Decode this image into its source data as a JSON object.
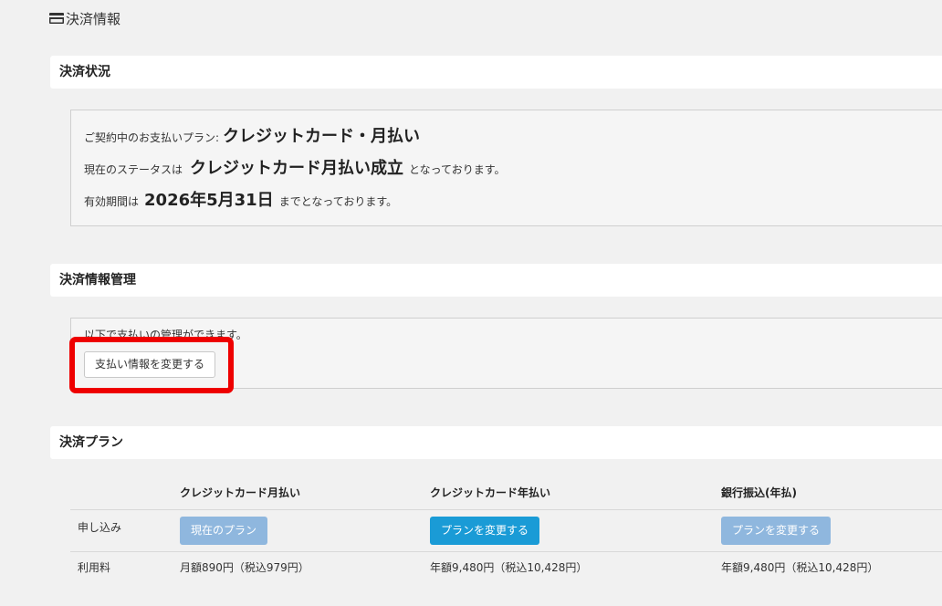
{
  "page": {
    "title": "決済情報",
    "icon": "credit-card-icon"
  },
  "status_section": {
    "heading": "決済状況",
    "plan_prefix": "ご契約中のお支払いプラン:",
    "plan_value": "クレジットカード・月払い",
    "status_prefix": "現在のステータスは",
    "status_value": "クレジットカード月払い成立",
    "status_suffix": "となっております。",
    "expiry_prefix": "有効期間は",
    "expiry_value": "2026年5月31日",
    "expiry_suffix": "までとなっております。"
  },
  "manage_section": {
    "heading": "決済情報管理",
    "description": "以下で支払いの管理ができます。",
    "change_button": "支払い情報を変更する"
  },
  "plan_section": {
    "heading": "決済プラン",
    "columns": [
      "",
      "クレジットカード月払い",
      "クレジットカード年払い",
      "銀行振込(年払)"
    ],
    "apply_label": "申し込み",
    "buttons": [
      "現在のプラン",
      "プランを変更する",
      "プランを変更する"
    ],
    "fee_label": "利用料",
    "fees": [
      "月額890円（税込979円）",
      "年額9,480円（税込10,428円）",
      "年額9,480円（税込10,428円）"
    ]
  },
  "colors": {
    "highlight": "#ee0000",
    "active_button": "#1a9bd6",
    "muted_button": "#8fb7de"
  }
}
